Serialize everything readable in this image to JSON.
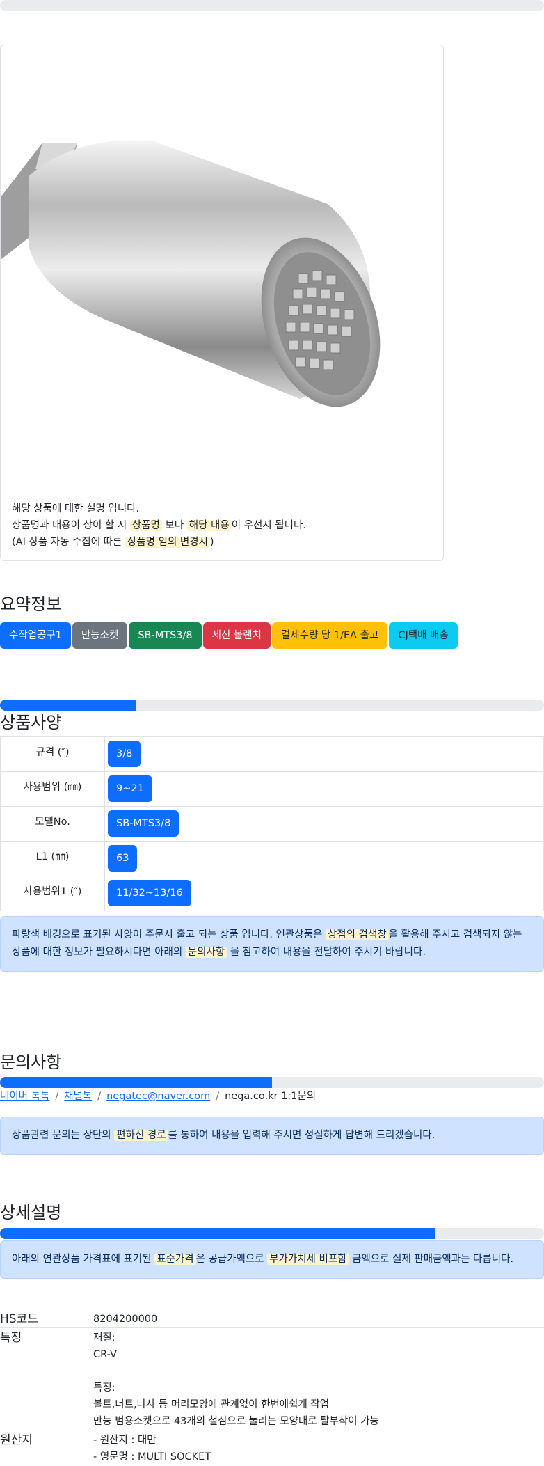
{
  "product": {
    "desc_line1": "해당 상품에 대한 설명 입니다.",
    "desc_line2_a": "상품명과 내용이 상이 할 시 ",
    "desc_line2_hl1": "상품명",
    "desc_line2_b": " 보다 ",
    "desc_line2_hl2": "해당 내용",
    "desc_line2_c": "이 우선시 됩니다.",
    "desc_line3_a": "(AI 상품 자동 수집에 따른 ",
    "desc_line3_hl": "상품명 임의 변경시",
    "desc_line3_b": ")"
  },
  "summary": {
    "title": "요약정보",
    "tags": [
      {
        "label": "수작업공구1",
        "color": "#0d6efd",
        "text": "#ffffff"
      },
      {
        "label": "만능소켓",
        "color": "#6c757d",
        "text": "#ffffff"
      },
      {
        "label": "SB-MTS3/8",
        "color": "#198754",
        "text": "#ffffff"
      },
      {
        "label": "세신 볼렌치",
        "color": "#dc3545",
        "text": "#ffffff"
      },
      {
        "label": "결제수량 당 1/EA 출고",
        "color": "#ffc107",
        "text": "#212529"
      },
      {
        "label": "CJ택배 배송",
        "color": "#0dcaf0",
        "text": "#212529"
      }
    ]
  },
  "spec": {
    "title": "상품사양",
    "progress": 0.25,
    "rows": [
      {
        "key": "규격 (″)",
        "value": "3/8"
      },
      {
        "key": "사용범위 (㎜)",
        "value": "9~21"
      },
      {
        "key": "모델No.",
        "value": "SB-MTS3/8"
      },
      {
        "key": "L1 (㎜)",
        "value": "63"
      },
      {
        "key": "사용범위1 (″)",
        "value": "11/32~13/16"
      }
    ],
    "notice_a": "파랑색 배경으로 표기된 사양이 주문시 출고 되는 상품 입니다. 연관상품은 ",
    "notice_hl1": "상점의 검색창",
    "notice_b": "을 활용해 주시고 검색되지 않는 상품에 대한 정보가 필요하시다면 아래의 ",
    "notice_hl2": "문의사항",
    "notice_c": " 을 참고하여 내용을 전달하여 주시기 바랍니다."
  },
  "inquiry": {
    "title": "문의사항",
    "progress": 0.5,
    "link1": "네이버 톡톡",
    "link2": "채널톡",
    "link3": "negatec@naver.com",
    "text4": "nega.co.kr 1:1문의",
    "sep": "/",
    "notice_a": "상품관련 문의는 상단의 ",
    "notice_hl": "편하신 경로",
    "notice_b": "를 통하여 내용을 입력해 주시면 성실하게 답변해 드리겠습니다."
  },
  "detail": {
    "title": "상세설명",
    "progress": 0.8,
    "notice_a": "아래의 연관상품 가격표에 표기된 ",
    "notice_hl1": "표준가격",
    "notice_b": "은 공급가액으로 ",
    "notice_hl2": "부가가치세 비포함",
    "notice_c": " 금액으로 실제 판매금액과는 다릅니다.",
    "rows": [
      {
        "key": "HS코드",
        "value": "8204200000"
      },
      {
        "key": "특징",
        "value": "재질:\nCR-V\n\n특징:\n볼트,너트,나사 등 머리모양에 관계없이 한번에쉽게 작업\n만능 범용소켓으로 43개의 철심으로 눌리는 모양대로 탈부착이 가능"
      },
      {
        "key": "원산지",
        "value": "- 원산지 : 대만\n- 영문명 : MULTI SOCKET"
      }
    ]
  }
}
